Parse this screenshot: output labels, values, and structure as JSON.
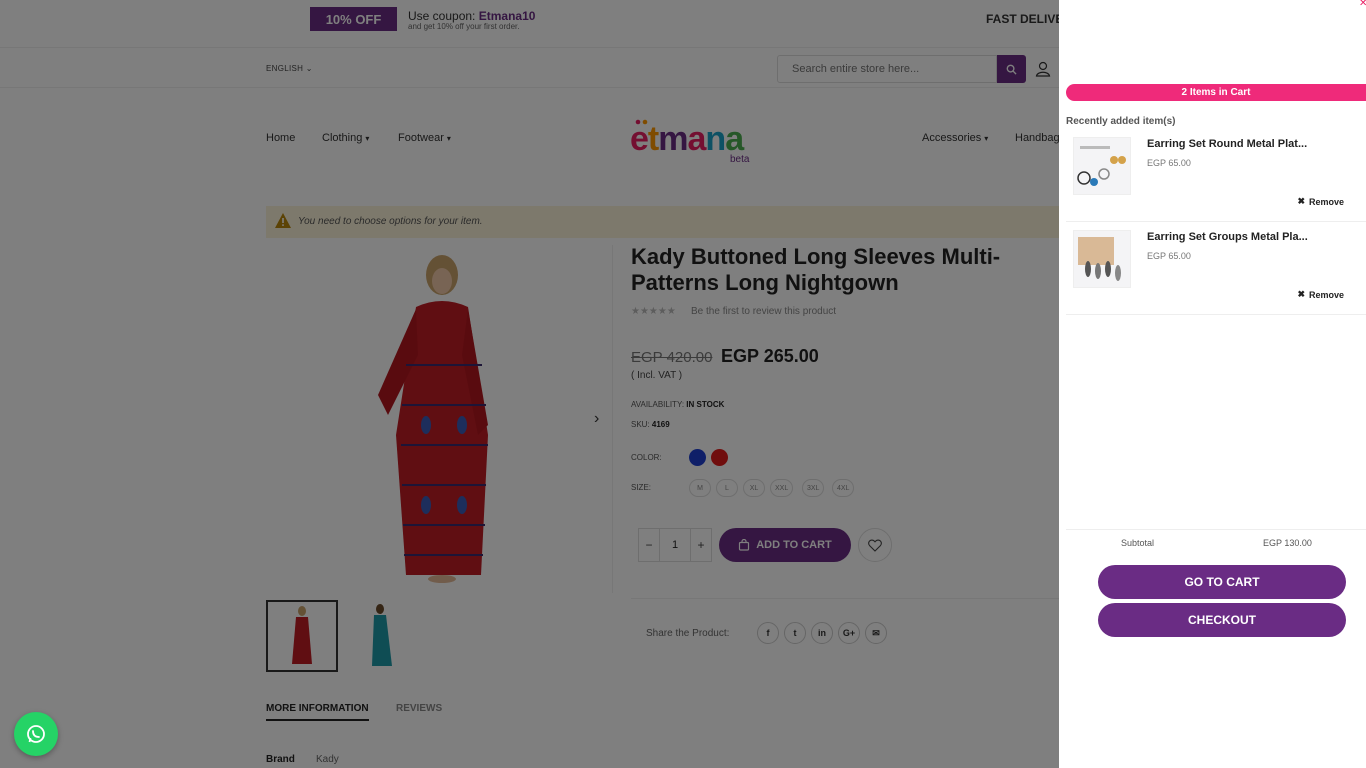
{
  "promo": {
    "badge": "10% OFF",
    "coupon_prefix": "Use coupon: ",
    "coupon_code": "Etmana10",
    "sub_text": "and get 10% off your first order.",
    "fast_delivery": "FAST DELIVE"
  },
  "header": {
    "language": "ENGLISH",
    "search_placeholder": "Search entire store here...",
    "logo_text": "etmana",
    "logo_sub": "beta"
  },
  "nav": {
    "left": [
      {
        "label": "Home"
      },
      {
        "label": "Clothing"
      },
      {
        "label": "Footwear"
      }
    ],
    "right": [
      {
        "label": "Accessories"
      },
      {
        "label": "Handbag"
      }
    ]
  },
  "notice": {
    "text": "You need to choose options for your item."
  },
  "product": {
    "title": "Kady Buttoned Long Sleeves Multi-Patterns Long Nightgown",
    "stars": "★★★★★",
    "review_text": "Be the first to review this product",
    "old_price": "EGP 420.00",
    "new_price": "EGP 265.00",
    "vat": "( Incl. VAT )",
    "availability_label": "AVAILABILITY: ",
    "availability_value": "IN STOCK",
    "sku_label": "SKU: ",
    "sku_value": "4169",
    "color_label": "COLOR:",
    "colors": [
      "#1e3fd1",
      "#e01b1b"
    ],
    "size_label": "SIZE:",
    "sizes": [
      "M",
      "L",
      "XL",
      "XXL",
      "3XL",
      "4XL"
    ],
    "qty": "1",
    "qty_minus": "−",
    "qty_plus": "+",
    "add_to_cart": "ADD TO CART",
    "share_label": "Share the Product:",
    "share_icons": [
      "f",
      "t",
      "in",
      "G+",
      "✉"
    ]
  },
  "tabs": {
    "more_info": "MORE INFORMATION",
    "reviews": "REVIEWS"
  },
  "details": {
    "brand_label": "Brand",
    "brand_value": "Kady"
  },
  "cart": {
    "count_label": "2 Items in Cart",
    "recent_label": "Recently added item(s)",
    "items": [
      {
        "name": "Earring Set Round Metal Plat...",
        "price": "EGP 65.00",
        "remove": "Remove"
      },
      {
        "name": "Earring Set Groups Metal Pla...",
        "price": "EGP 65.00",
        "remove": "Remove"
      }
    ],
    "subtotal_label": "Subtotal",
    "subtotal_value": "EGP 130.00",
    "go_to_cart": "GO TO CART",
    "checkout": "CHECKOUT"
  },
  "colors": {
    "brand_purple": "#6a2c84",
    "cart_pink": "#ef2a7a",
    "whatsapp_green": "#25d366"
  }
}
